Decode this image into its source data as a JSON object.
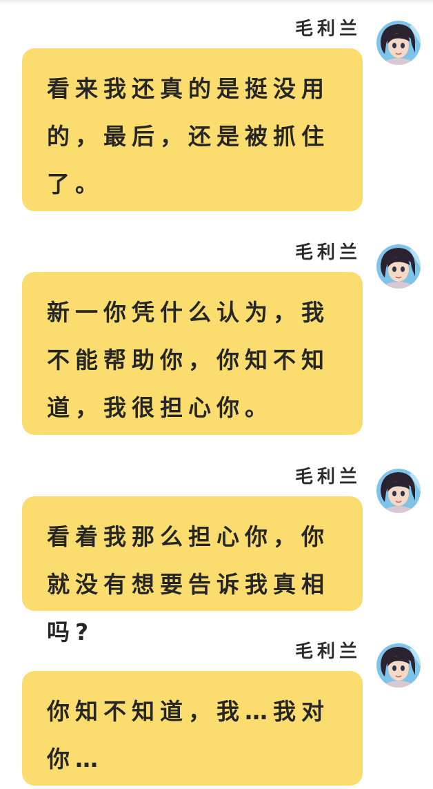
{
  "colors": {
    "bubble": "#fbdd6f",
    "text": "#262626",
    "sender": "#2b2b2b",
    "background": "#ffffff"
  },
  "messages": [
    {
      "sender": "毛利兰",
      "avatar_icon": "avatar-ran-mouri-icon",
      "text": "看来我还真的是挺没用的，最后，还是被抓住了。"
    },
    {
      "sender": "毛利兰",
      "avatar_icon": "avatar-ran-mouri-icon",
      "text": "新一你凭什么认为，我不能帮助你，你知不知道，我很担心你。"
    },
    {
      "sender": "毛利兰",
      "avatar_icon": "avatar-ran-mouri-icon",
      "text": "看着我那么担心你，你就没有想要告诉我真相吗?"
    },
    {
      "sender": "毛利兰",
      "avatar_icon": "avatar-ran-mouri-icon",
      "text": "你知不知道，我…我对你…"
    }
  ]
}
